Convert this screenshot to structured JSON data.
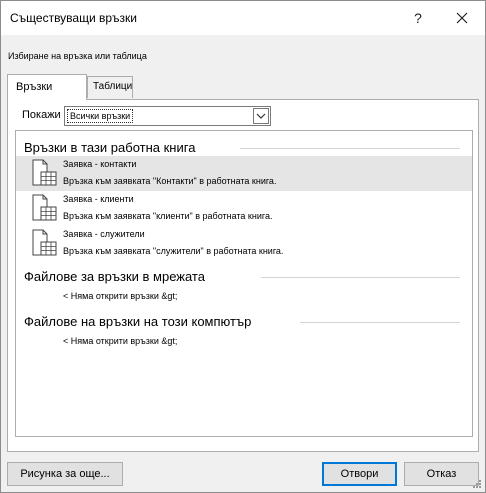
{
  "window": {
    "title": "Съществуващи връзки",
    "help_label": "?"
  },
  "subtitle": "Избиране на връзка или таблица",
  "tabs": [
    {
      "label": "Връзки",
      "active": true
    },
    {
      "label": "Таблици",
      "active": false
    }
  ],
  "filter": {
    "label": "Покажи",
    "value": "Всички връзки"
  },
  "sections": [
    {
      "heading": "Връзки в тази работна книга",
      "items": [
        {
          "name": "Заявка - контакти",
          "description": "Връзка към заявката \"Контакти\" в работната книга.",
          "selected": true
        },
        {
          "name": "Заявка - клиенти",
          "description": "Връзка към заявката \"клиенти\" в работната книга.",
          "selected": false
        },
        {
          "name": "Заявка - служители",
          "description": "Връзка към заявката \"служители\" в работната книга.",
          "selected": false
        }
      ]
    },
    {
      "heading": "Файлове за връзки в мрежата",
      "empty_text": "< Няма открити връзки &gt;"
    },
    {
      "heading": "Файлове на връзки на този компютър",
      "empty_text": "< Няма открити връзки &gt;"
    }
  ],
  "buttons": {
    "browse": "Рисунка за още...",
    "open": "Отвори",
    "cancel": "Отказ"
  },
  "colors": {
    "accent": "#0078d7",
    "selection": "#e5e5e5"
  },
  "icons": {
    "close": "close-icon",
    "dropdown": "chevron-down-icon",
    "connection": "table-connection-icon"
  }
}
